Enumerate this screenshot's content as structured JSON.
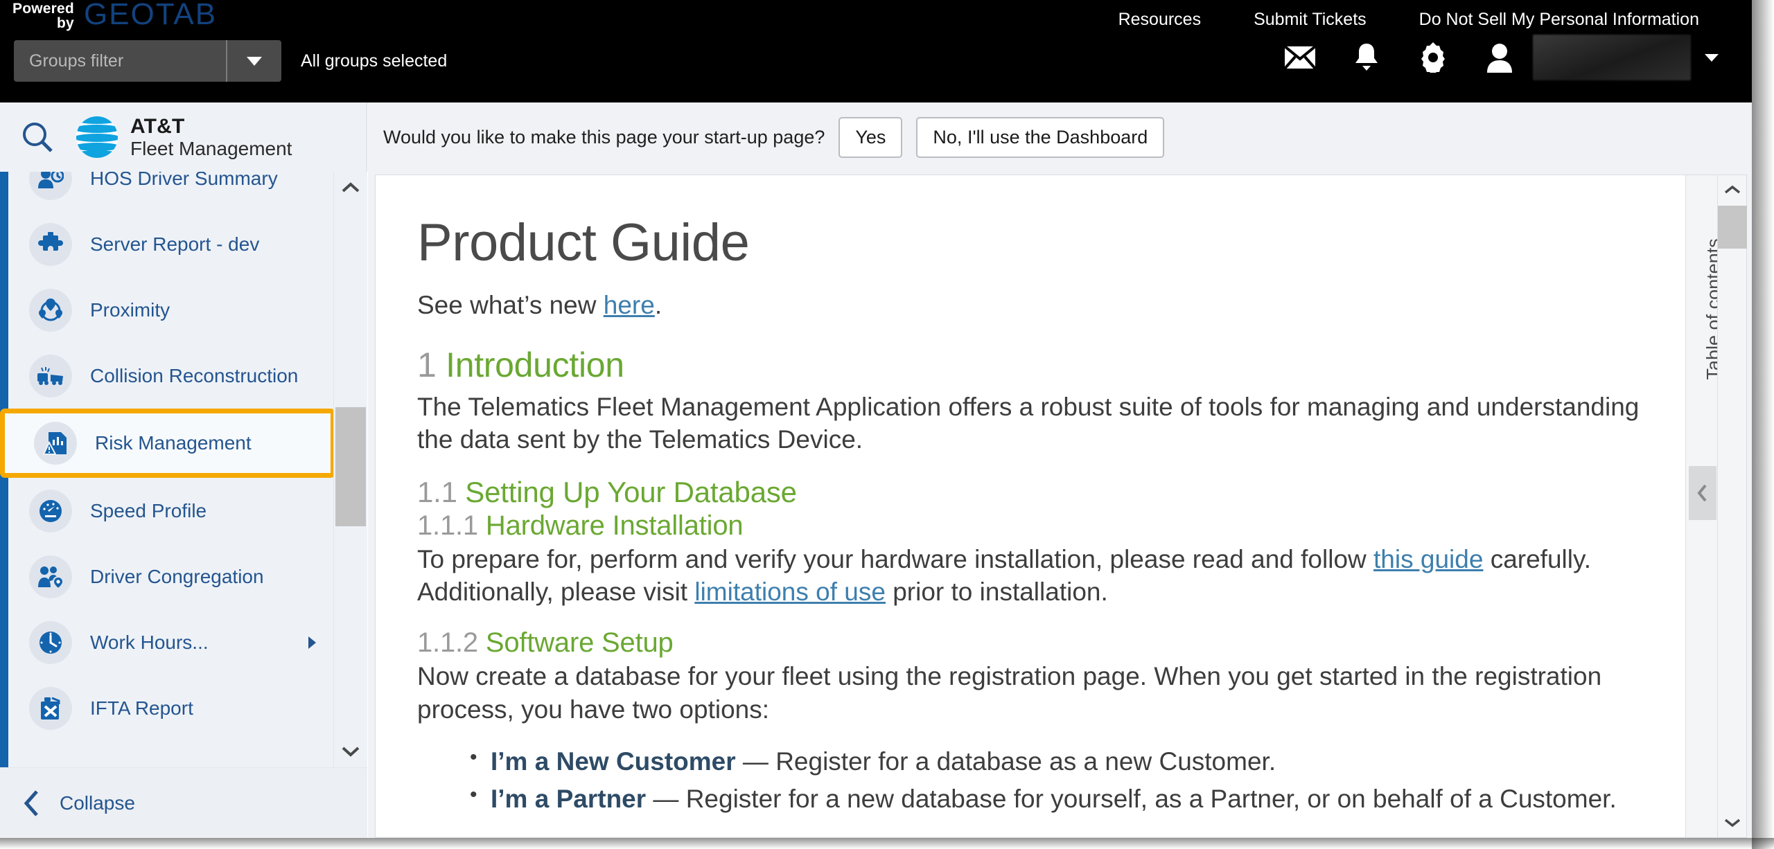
{
  "topbar": {
    "powered_line1": "Powered",
    "powered_line2": "by",
    "brand_word": "GEOTAB",
    "nav": [
      {
        "label": "Resources"
      },
      {
        "label": "Submit Tickets"
      },
      {
        "label": "Do Not Sell My Personal Information"
      }
    ],
    "groups_filter_placeholder": "Groups filter",
    "groups_filter_value": "",
    "groups_selected_label": "All groups selected",
    "icons": [
      {
        "name": "mail-icon"
      },
      {
        "name": "bell-icon"
      },
      {
        "name": "gear-icon"
      },
      {
        "name": "person-icon"
      }
    ],
    "user_name_redacted": ""
  },
  "sidebar": {
    "product_line1": "AT&T",
    "product_line2": "Fleet Management",
    "search_icon": "search-icon",
    "items": [
      {
        "label": "HOS Driver Summary",
        "icon": "hos-driver-summary-icon",
        "selected": false,
        "has_submenu": false
      },
      {
        "label": "Server Report - dev",
        "icon": "puzzle-piece-icon",
        "selected": false,
        "has_submenu": false
      },
      {
        "label": "Proximity",
        "icon": "proximity-icon",
        "selected": false,
        "has_submenu": false
      },
      {
        "label": "Collision Reconstruction",
        "icon": "collision-icon",
        "selected": false,
        "has_submenu": false
      },
      {
        "label": "Risk Management",
        "icon": "risk-management-icon",
        "selected": true,
        "has_submenu": false
      },
      {
        "label": "Speed Profile",
        "icon": "speedometer-icon",
        "selected": false,
        "has_submenu": false
      },
      {
        "label": "Driver Congregation",
        "icon": "driver-congregation-icon",
        "selected": false,
        "has_submenu": false
      },
      {
        "label": "Work Hours...",
        "icon": "clock-icon",
        "selected": false,
        "has_submenu": true
      },
      {
        "label": "IFTA Report",
        "icon": "fuel-can-icon",
        "selected": false,
        "has_submenu": false
      }
    ],
    "collapse_label": "Collapse",
    "selection_highlight_color": "#f5a800",
    "accent_color": "#1463ad"
  },
  "startup_prompt": {
    "question": "Would you like to make this page your start-up page?",
    "yes_label": "Yes",
    "no_label": "No, I'll use the Dashboard"
  },
  "document": {
    "title": "Product Guide",
    "see_new_prefix": "See what’s new ",
    "see_new_link": "here",
    "see_new_suffix": ".",
    "sections": {
      "intro_num": "1",
      "intro_title": "Introduction",
      "intro_body": "The Telematics Fleet Management Application offers a robust suite of tools for managing and understanding the data sent by the Telematics Device.",
      "s11_num": "1.1",
      "s11_title": "Setting Up Your Database",
      "s111_num": "1.1.1",
      "s111_title": "Hardware Installation",
      "s111_body_a": "To prepare for, perform and verify your hardware installation, please read and follow ",
      "s111_link_a": "this guide",
      "s111_body_b": " carefully. Additionally, please visit ",
      "s111_link_b": "limitations of use",
      "s111_body_c": " prior to installation.",
      "s112_num": "1.1.2",
      "s112_title": "Software Setup",
      "s112_body": "Now create a database for your fleet using the registration page. When you get started in the registration process, you have two options:",
      "options": [
        {
          "bold": "I’m a New Customer",
          "rest": " — Register for a database as a new Customer."
        },
        {
          "bold": "I’m a Partner",
          "rest": " — Register for a new database for yourself, as a Partner, or on behalf of a Customer."
        }
      ]
    },
    "toc_label": "Table of contents",
    "heading_color": "#6aa832",
    "link_color": "#3d7fad"
  }
}
